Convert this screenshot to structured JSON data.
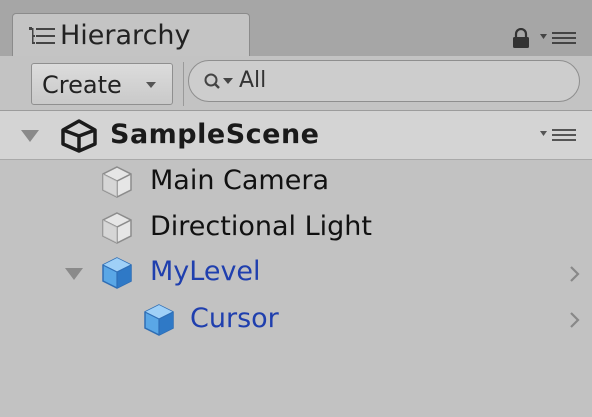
{
  "tab": {
    "label": "Hierarchy",
    "icon": "hierarchy-list-icon"
  },
  "toolbar": {
    "create_label": "Create",
    "search_placeholder": "All"
  },
  "scene": {
    "label": "SampleScene",
    "icon": "unity-logo-icon",
    "expanded": true
  },
  "items": [
    {
      "label": "Main Camera",
      "icon": "gameobject-cube-icon",
      "prefab": false
    },
    {
      "label": "Directional Light",
      "icon": "gameobject-cube-icon",
      "prefab": false
    },
    {
      "label": "MyLevel",
      "icon": "prefab-cube-icon",
      "prefab": true,
      "expanded": true
    },
    {
      "label": "Cursor",
      "icon": "prefab-cube-icon",
      "prefab": true
    }
  ],
  "colors": {
    "prefab_text": "#1f3fae",
    "panel_bg": "#c2c2c2",
    "tab_strip_bg": "#a6a6a6"
  }
}
